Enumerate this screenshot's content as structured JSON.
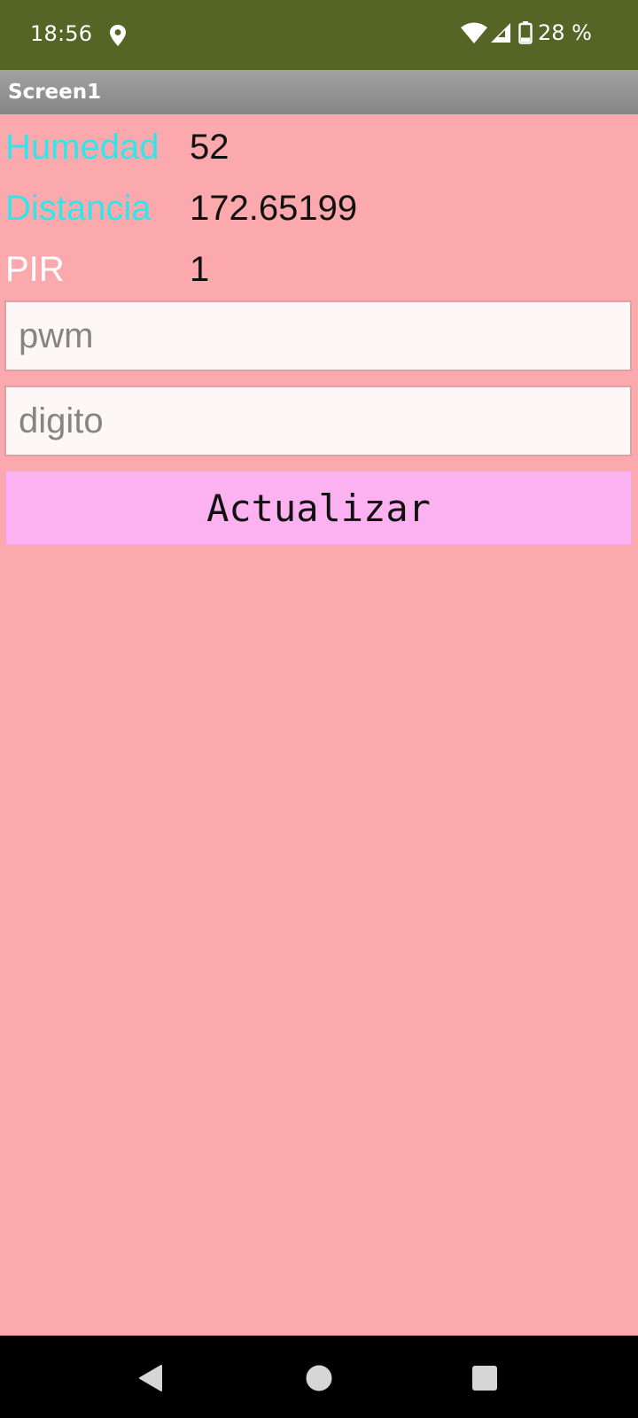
{
  "status_bar": {
    "time": "18:56",
    "battery_text": "28 %",
    "icons": [
      "location-icon",
      "wifi-icon",
      "signal-icon",
      "battery-icon"
    ]
  },
  "title_bar": {
    "title": "Screen1"
  },
  "readings": [
    {
      "label": "Humedad",
      "value": "52"
    },
    {
      "label": "Distancia",
      "value": "172.65199"
    },
    {
      "label": "PIR",
      "value": "1"
    }
  ],
  "inputs": {
    "pwm": {
      "placeholder": "pwm",
      "value": ""
    },
    "digito": {
      "placeholder": "digito",
      "value": ""
    }
  },
  "button": {
    "label": "Actualizar"
  },
  "nav_bar": {
    "icons": [
      "back-icon",
      "home-icon",
      "recents-icon"
    ]
  },
  "colors": {
    "status_bar": "#546525",
    "background": "#fca9ad",
    "label_cyan": "#31e6ea",
    "button": "#fcb1f0"
  }
}
